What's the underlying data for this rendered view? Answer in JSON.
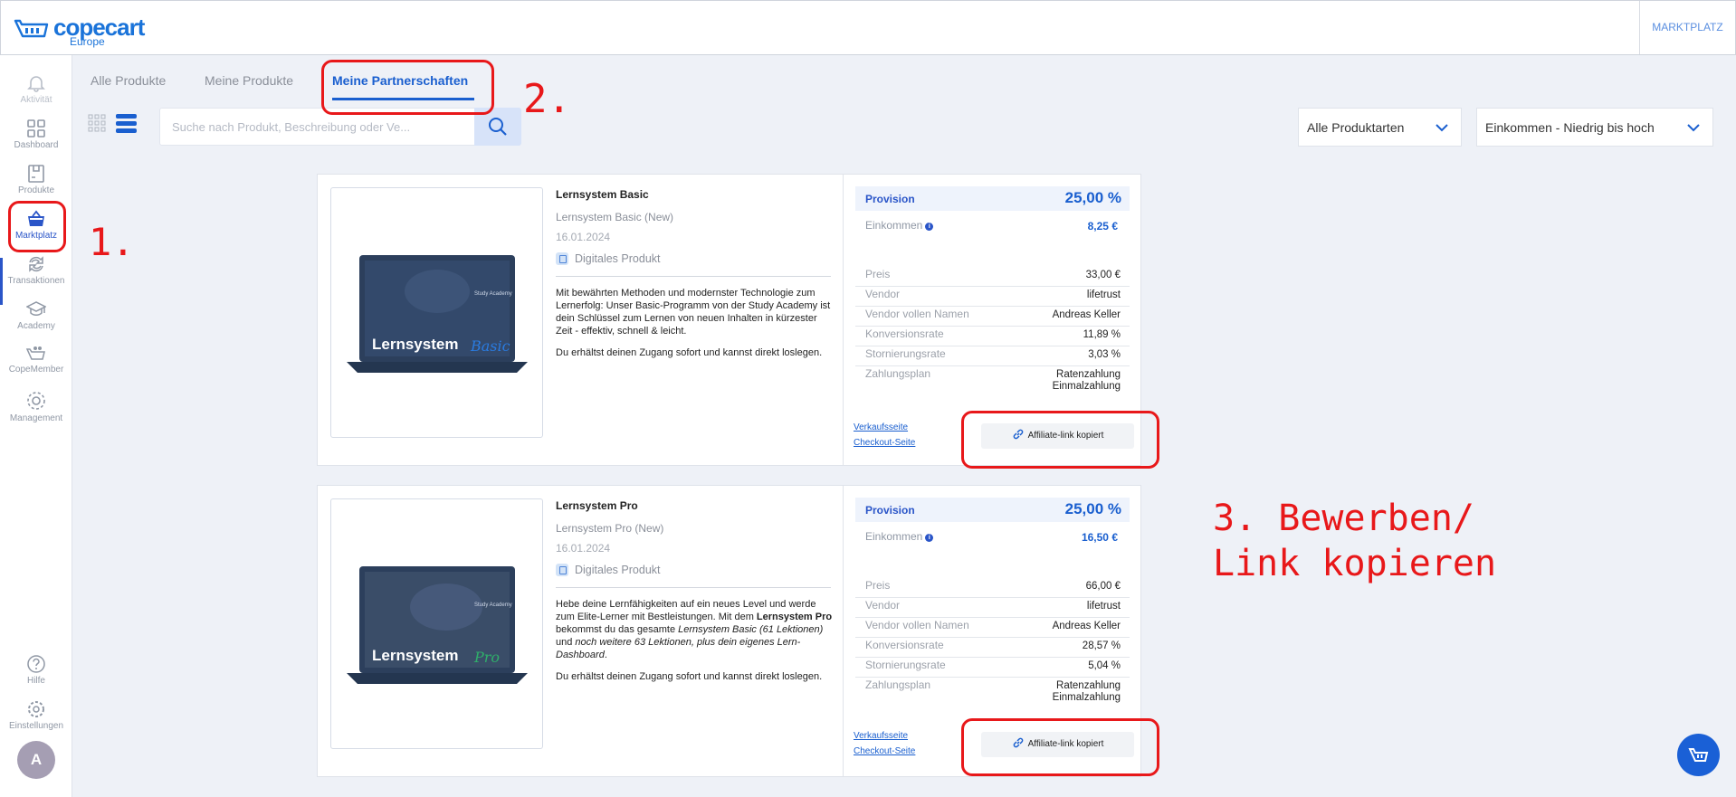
{
  "brand": {
    "name": "copecart",
    "sub": "Europe"
  },
  "topbar": {
    "right_label": "MARKTPLATZ"
  },
  "sidebar": {
    "items": [
      {
        "label": "Aktivität",
        "icon": "bell-icon"
      },
      {
        "label": "Dashboard",
        "icon": "grid-icon"
      },
      {
        "label": "Produkte",
        "icon": "box-icon"
      },
      {
        "label": "Marktplatz",
        "icon": "basket-icon"
      },
      {
        "label": "Transaktionen",
        "icon": "exchange-icon"
      },
      {
        "label": "Academy",
        "icon": "graduation-cap-icon"
      },
      {
        "label": "CopeMember",
        "icon": "members-icon"
      },
      {
        "label": "Management",
        "icon": "cog-group-icon"
      }
    ],
    "bottom": [
      {
        "label": "Hilfe",
        "icon": "help-icon"
      },
      {
        "label": "Einstellungen",
        "icon": "settings-icon"
      }
    ],
    "avatar": "A"
  },
  "tabs": [
    "Alle Produkte",
    "Meine Produkte",
    "Meine Partnerschaften"
  ],
  "search": {
    "placeholder": "Suche nach Produkt, Beschreibung oder Ve..."
  },
  "filters": {
    "type": "Alle Produktarten",
    "sort": "Einkommen - Niedrig bis hoch"
  },
  "products": [
    {
      "title": "Lernsystem Basic",
      "subtitle": "Lernsystem Basic (New)",
      "date": "16.01.2024",
      "type": "Digitales Produkt",
      "image_title": "Lernsystem",
      "image_tag": "Basic",
      "image_brand": "Study Academy",
      "desc1": "Mit bewährten Methoden und modernster Technologie zum Lernerfolg: Unser Basic-Programm von der Study Academy ist dein Schlüssel zum Lernen von neuen Inhalten in kürzester Zeit - effektiv, schnell & leicht.",
      "desc2": "Du erhältst deinen Zugang sofort und kannst direkt loslegen.",
      "provision_label": "Provision",
      "provision": "25,00 %",
      "einkommen_label": "Einkommen",
      "einkommen": "8,25 €",
      "details": [
        {
          "k": "Preis",
          "v": "33,00 €"
        },
        {
          "k": "Vendor",
          "v": "lifetrust"
        },
        {
          "k": "Vendor vollen Namen",
          "v": "Andreas Keller"
        },
        {
          "k": "Konversionsrate",
          "v": "11,89 %"
        },
        {
          "k": "Stornierungsrate",
          "v": "3,03 %"
        },
        {
          "k": "Zahlungsplan",
          "v": "Ratenzahlung",
          "v2": "Einmalzahlung"
        }
      ],
      "link1": "Verkaufsseite",
      "link2": "Checkout-Seite",
      "button": "Affiliate-link kopiert"
    },
    {
      "title": "Lernsystem Pro",
      "subtitle": "Lernsystem Pro (New)",
      "date": "16.01.2024",
      "type": "Digitales Produkt",
      "image_title": "Lernsystem",
      "image_tag": "Pro",
      "image_brand": "Study Academy",
      "desc_a": "Hebe deine Lernfähigkeiten auf ein neues Level und werde zum Elite-Lerner mit Bestleistungen. Mit dem ",
      "desc_b": "Lernsystem Pro",
      "desc_c": " bekommst du das gesamte ",
      "desc_d": "Lernsystem Basic (61 Lektionen)",
      "desc_e": " und ",
      "desc_f": "noch weitere 63 Lektionen, plus dein eigenes Lern-Dashboard",
      "desc_g": ".",
      "desc2": "Du erhältst deinen Zugang sofort und kannst direkt loslegen.",
      "provision_label": "Provision",
      "provision": "25,00 %",
      "einkommen_label": "Einkommen",
      "einkommen": "16,50 €",
      "details": [
        {
          "k": "Preis",
          "v": "66,00 €"
        },
        {
          "k": "Vendor",
          "v": "lifetrust"
        },
        {
          "k": "Vendor vollen Namen",
          "v": "Andreas Keller"
        },
        {
          "k": "Konversionsrate",
          "v": "28,57 %"
        },
        {
          "k": "Stornierungsrate",
          "v": "5,04 %"
        },
        {
          "k": "Zahlungsplan",
          "v": "Ratenzahlung",
          "v2": "Einmalzahlung"
        }
      ],
      "link1": "Verkaufsseite",
      "link2": "Checkout-Seite",
      "button": "Affiliate-link kopiert"
    }
  ],
  "annotations": {
    "a1": "1.",
    "a2": "2.",
    "a3_line1": "3. Bewerben/",
    "a3_line2": "Link kopieren",
    "color": "#e8181a"
  }
}
